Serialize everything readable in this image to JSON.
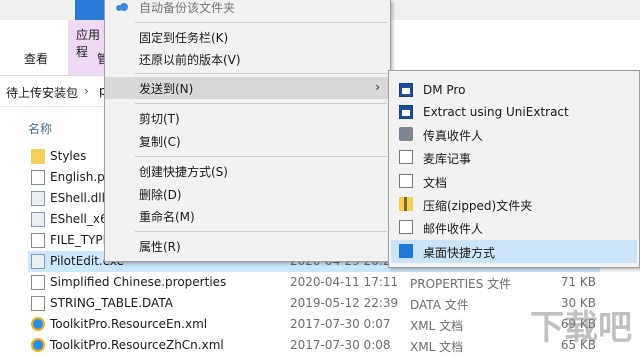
{
  "ribbon": {
    "app_tab": "应用程",
    "view_tab": "查看",
    "pin_tab": "管"
  },
  "address": {
    "crumb": "待上传安装包",
    "chevron": "›",
    "path_tail": "p"
  },
  "list": {
    "column_name": "名称",
    "rows": [
      {
        "name": "Styles",
        "date": "",
        "type": "",
        "size": "",
        "icon": "folder-icon"
      },
      {
        "name": "English.pr",
        "date": "",
        "type": "",
        "size": "",
        "icon": "document-icon"
      },
      {
        "name": "EShell.dll",
        "date": "",
        "type": "",
        "size": "",
        "icon": "dll-icon"
      },
      {
        "name": "EShell_x64",
        "date": "",
        "type": "",
        "size": "",
        "icon": "dll-icon"
      },
      {
        "name": "FILE_TYPE",
        "date": "",
        "type": "",
        "size": "",
        "icon": "document-icon"
      },
      {
        "name": "PilotEdit.exe",
        "date": "2020-04-29 20:2",
        "type": "",
        "size": "",
        "icon": "exe-icon"
      },
      {
        "name": "Simplified Chinese.properties",
        "date": "2020-04-11 17:11",
        "type": "PROPERTIES 文件",
        "size": "71 KB",
        "icon": "document-icon"
      },
      {
        "name": "STRING_TABLE.DATA",
        "date": "2019-05-12 22:39",
        "type": "DATA 文件",
        "size": "30 KB",
        "icon": "document-icon"
      },
      {
        "name": "ToolkitPro.ResourceEn.xml",
        "date": "2017-07-30 0:07",
        "type": "XML 文档",
        "size": "69 KB",
        "icon": "ie-icon"
      },
      {
        "name": "ToolkitPro.ResourceZhCn.xml",
        "date": "2017-07-30 0:08",
        "type": "XML 文档",
        "size": "65 KB",
        "icon": "ie-icon"
      }
    ]
  },
  "context_menu": {
    "auto_backup": "自动备份该文件夹",
    "pin_taskbar": "固定到任务栏(K)",
    "restore": "还原以前的版本(V)",
    "send_to": "发送到(N)",
    "send_to_arrow": "›",
    "cut": "剪切(T)",
    "copy": "复制(C)",
    "shortcut": "创建快捷方式(S)",
    "delete": "删除(D)",
    "rename": "重命名(M)",
    "properties": "属性(R)"
  },
  "submenu": {
    "items": [
      {
        "label": "DM Pro",
        "icon": "window-icon"
      },
      {
        "label": "Extract using UniExtract",
        "icon": "window-icon"
      },
      {
        "label": "传真收件人",
        "icon": "fax-icon"
      },
      {
        "label": "麦库记事",
        "icon": "document-icon"
      },
      {
        "label": "文档",
        "icon": "documents-icon"
      },
      {
        "label": "压缩(zipped)文件夹",
        "icon": "zip-folder-icon"
      },
      {
        "label": "邮件收件人",
        "icon": "mail-icon"
      },
      {
        "label": "桌面快捷方式",
        "icon": "desktop-icon"
      }
    ]
  },
  "watermark": "下载吧",
  "colors": {
    "accent": "#2b79d6",
    "selection": "#cce8ff",
    "menu_bg": "#f2f2f2",
    "submenu_highlight": "#cce4f7"
  }
}
